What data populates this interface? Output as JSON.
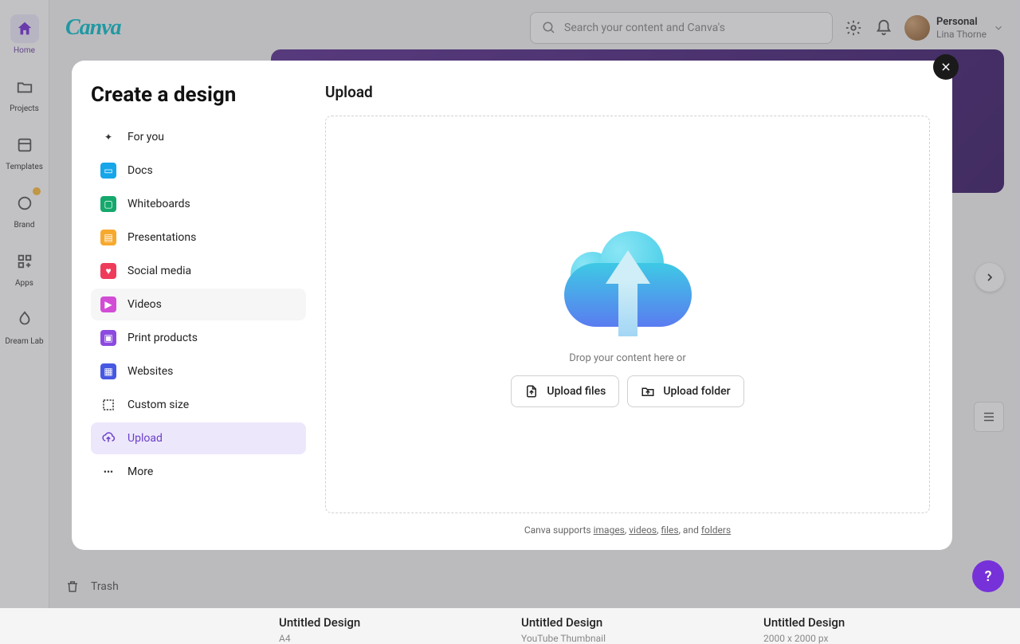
{
  "nav_rail": [
    {
      "label": "Home",
      "active": true
    },
    {
      "label": "Projects"
    },
    {
      "label": "Templates"
    },
    {
      "label": "Brand",
      "crown": true
    },
    {
      "label": "Apps"
    },
    {
      "label": "Dream Lab"
    }
  ],
  "logo": "Canva",
  "search_placeholder": "Search your content and Canva's",
  "account": {
    "plan": "Personal",
    "name": "Lina Thorne"
  },
  "trash_label": "Trash",
  "recent_designs": [
    {
      "title": "Untitled Design",
      "subtitle": "A4"
    },
    {
      "title": "Untitled Design",
      "subtitle": "YouTube Thumbnail"
    },
    {
      "title": "Untitled Design",
      "subtitle": "2000 x 2000 px"
    }
  ],
  "modal": {
    "title": "Create a design",
    "menu": [
      {
        "label": "For you",
        "icon": "foryou"
      },
      {
        "label": "Docs",
        "icon": "docs"
      },
      {
        "label": "Whiteboards",
        "icon": "wb"
      },
      {
        "label": "Presentations",
        "icon": "pres"
      },
      {
        "label": "Social media",
        "icon": "social"
      },
      {
        "label": "Videos",
        "icon": "video",
        "hover": true
      },
      {
        "label": "Print products",
        "icon": "print"
      },
      {
        "label": "Websites",
        "icon": "web"
      },
      {
        "label": "Custom size",
        "icon": "custom"
      },
      {
        "label": "Upload",
        "icon": "upload",
        "active": true
      },
      {
        "label": "More",
        "icon": "more"
      }
    ],
    "right": {
      "heading": "Upload",
      "drop_text": "Drop your content here or",
      "upload_files": "Upload files",
      "upload_folder": "Upload folder",
      "support_prefix": "Canva supports ",
      "support_links": [
        "images",
        "videos",
        "files",
        "folders"
      ],
      "support_sep": [
        ", ",
        ", ",
        ", and "
      ]
    }
  },
  "help": "?"
}
